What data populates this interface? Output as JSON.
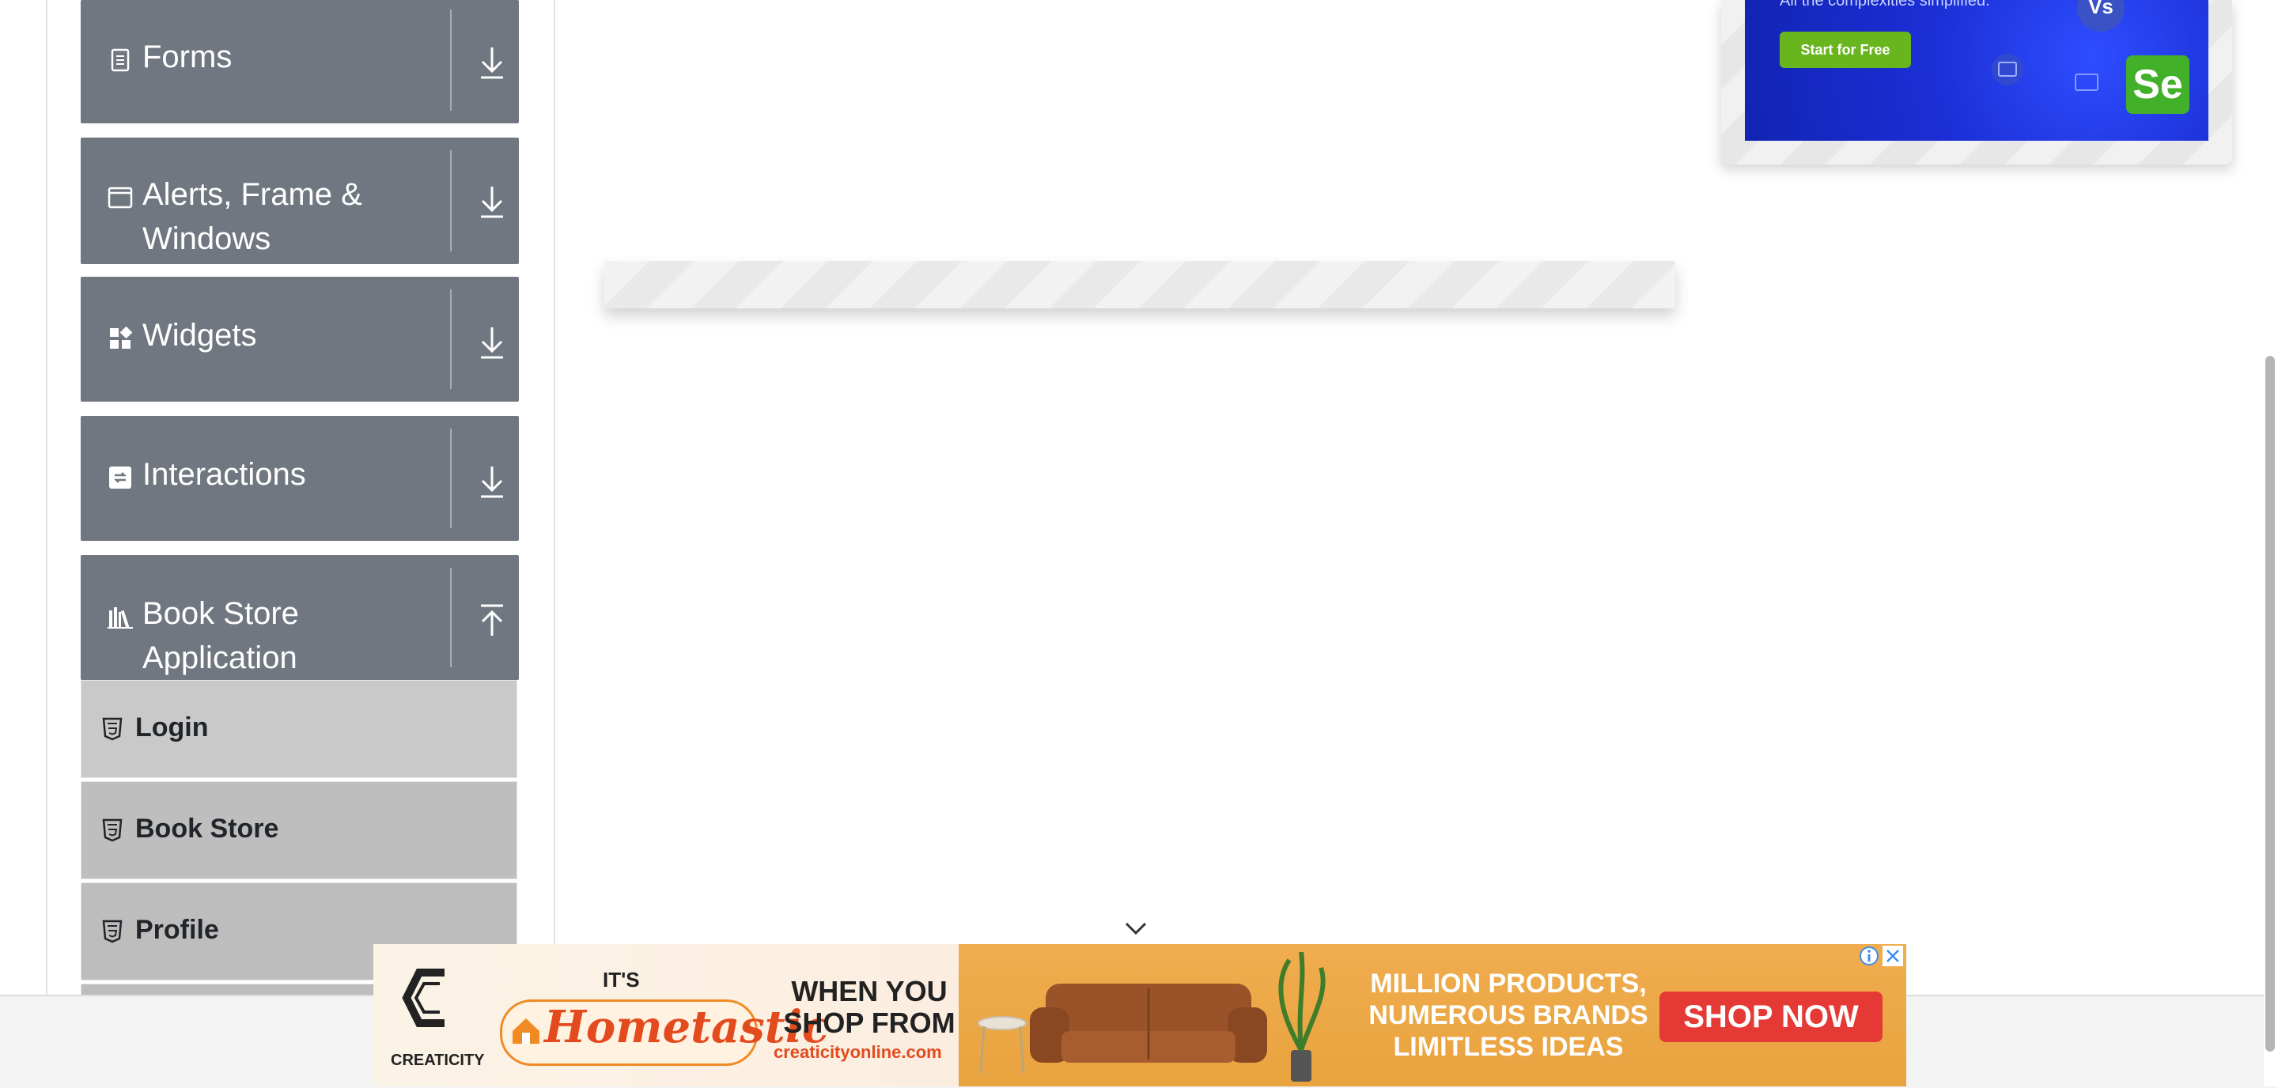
{
  "sidebar": {
    "groups": [
      {
        "label": "Forms",
        "icon": "form-icon",
        "state": "collapsed"
      },
      {
        "label": "Alerts, Frame &",
        "label2": "Windows",
        "icon": "window-icon",
        "state": "collapsed"
      },
      {
        "label": "Widgets",
        "icon": "widgets-icon",
        "state": "collapsed"
      },
      {
        "label": "Interactions",
        "icon": "interactions-icon",
        "state": "collapsed"
      },
      {
        "label": "Book Store",
        "label2": "Application",
        "icon": "bookshelf-icon",
        "state": "expanded"
      }
    ],
    "book_store_items": [
      {
        "label": "Login",
        "icon": "html5-icon"
      },
      {
        "label": "Book Store",
        "icon": "html5-icon"
      },
      {
        "label": "Profile",
        "icon": "html5-icon"
      }
    ]
  },
  "ads": {
    "top": {
      "subtitle": "All the complexities simplified.",
      "cta_label": "Start for Free",
      "badge_text": "Se",
      "vs_text": "Vs"
    },
    "bottom": {
      "brand": "CREATICITY",
      "its": "IT'S",
      "hometastic": "Hometastic",
      "line1": "WHEN YOU",
      "line2": "SHOP FROM",
      "site": "creaticityonline.com",
      "million1": "MILLION PRODUCTS,",
      "million2": "NUMEROUS BRANDS",
      "million3": "LIMITLESS IDEAS",
      "shop_now": "SHOP NOW"
    }
  },
  "colors": {
    "group_bg": "#717780",
    "menu_item_bg": "#c8c8c8",
    "menu_item_bg_active": "#bfbfbf",
    "ad_orange": "#f0ad4e",
    "ad_red": "#e53935"
  }
}
